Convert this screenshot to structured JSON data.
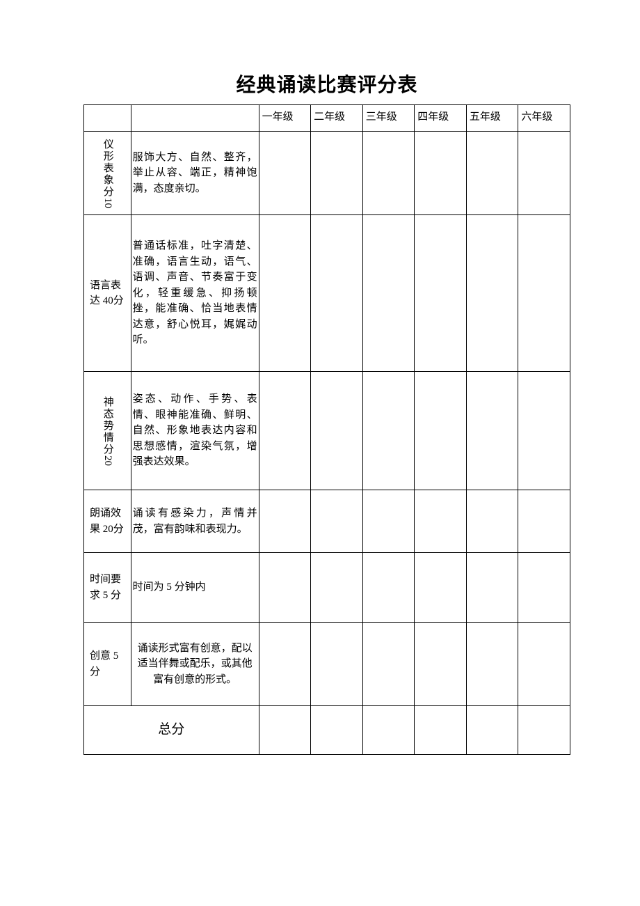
{
  "title": "经典诵读比赛评分表",
  "headers": {
    "g1": "一年级",
    "g2": "二年级",
    "g3": "三年级",
    "g4": "四年级",
    "g5": "五年级",
    "g6": "六年级"
  },
  "rows": [
    {
      "category_vert": "仪形表象分 10",
      "category_h": "",
      "desc": "服饰大方、自然、整齐，举止从容、端正，精神饱满，态度亲切。"
    },
    {
      "category_vert": "",
      "category_h": "语言表达 40分",
      "desc": "普通话标准，吐字清楚、准确，语言生动，语气、语调、声音、节奏富于变化，轻重缓急、抑扬顿挫，能准确、恰当地表情达意，舒心悦耳，娓娓动听。"
    },
    {
      "category_vert": "神态势情分 20",
      "category_h": "",
      "desc": "姿态、动作、手势、表情、眼神能准确、鲜明、自然、形象地表达内容和思想感情，渲染气氛，增强表达效果。"
    },
    {
      "category_vert": "",
      "category_h": "朗诵效果 20分",
      "desc": "诵读有感染力，声情并茂，富有韵味和表现力。"
    },
    {
      "category_vert": "",
      "category_h": "时间要求 5 分",
      "desc": "时间为 5 分钟内"
    },
    {
      "category_vert": "",
      "category_h": "创意 5分",
      "desc": "诵读形式富有创意，配以适当伴舞或配乐，或其他富有创意的形式。"
    }
  ],
  "total_label": "总分"
}
